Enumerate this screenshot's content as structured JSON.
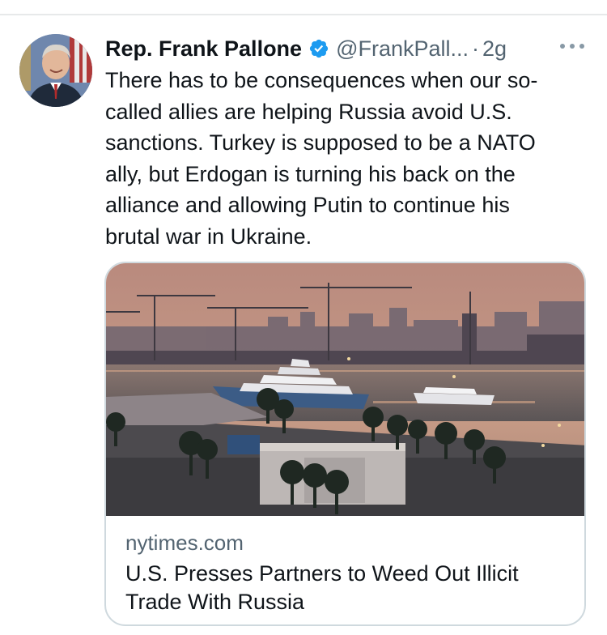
{
  "tweet": {
    "display_name": "Rep. Frank Pallone",
    "handle": "@FrankPall...",
    "separator": "·",
    "time": "2g",
    "text": "There has to be consequences when our so-\ncalled allies are helping Russia avoid U.S.\nsanctions. Turkey is supposed to be a NATO\nally, but Erdogan is turning his back on the\nalliance and allowing Putin to continue his\nbrutal war in Ukraine.",
    "avatar_icon": "profile-photo",
    "verified_icon": "verified-badge-icon",
    "verified_color": "#1d9bf0",
    "more_icon": "more-horizontal-icon"
  },
  "card": {
    "domain": "nytimes.com",
    "title": "U.S. Presses Partners to Weed Out Illicit Trade With Russia"
  },
  "colors": {
    "text_primary": "#0f1419",
    "text_secondary": "#536471",
    "border": "#cfd9de"
  }
}
